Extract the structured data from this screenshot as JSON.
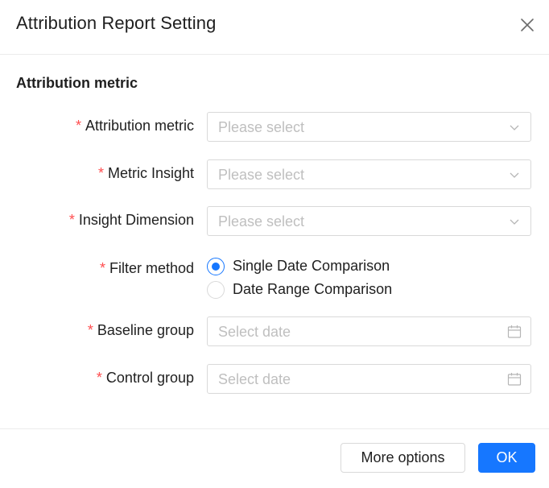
{
  "dialog": {
    "title": "Attribution Report Setting",
    "close_icon": "close-icon"
  },
  "section": {
    "title": "Attribution metric"
  },
  "form": {
    "required_mark": "*",
    "attribution_metric": {
      "label": "Attribution metric",
      "placeholder": "Please select",
      "icon": "chevron-down-icon"
    },
    "metric_insight": {
      "label": "Metric Insight",
      "placeholder": "Please select",
      "icon": "chevron-down-icon"
    },
    "insight_dimension": {
      "label": "Insight Dimension",
      "placeholder": "Please select",
      "icon": "chevron-down-icon"
    },
    "filter_method": {
      "label": "Filter method",
      "options": [
        {
          "label": "Single Date Comparison",
          "checked": true
        },
        {
          "label": "Date Range Comparison",
          "checked": false
        }
      ]
    },
    "baseline_group": {
      "label": "Baseline group",
      "placeholder": "Select date",
      "icon": "calendar-icon"
    },
    "control_group": {
      "label": "Control group",
      "placeholder": "Select date",
      "icon": "calendar-icon"
    }
  },
  "footer": {
    "more_options_label": "More options",
    "ok_label": "OK"
  },
  "colors": {
    "primary": "#1677ff",
    "required": "#ff4d4f",
    "placeholder": "#bfbfbf",
    "border": "#d9d9d9"
  }
}
